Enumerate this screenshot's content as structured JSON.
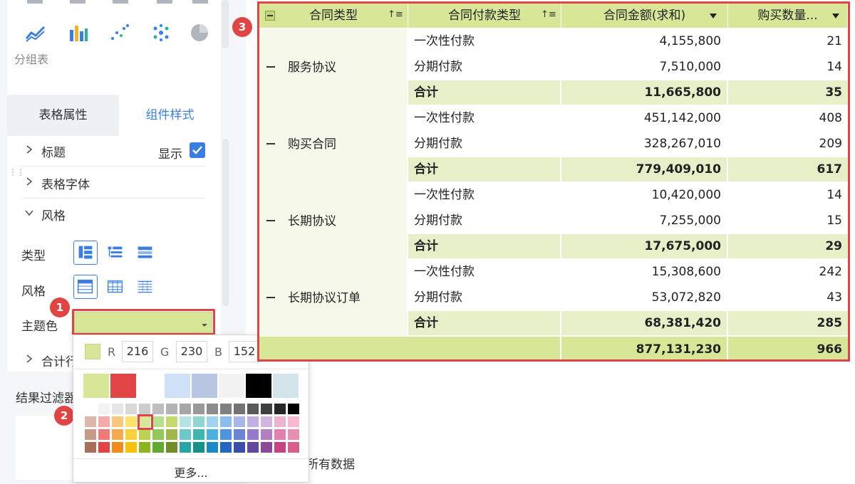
{
  "left_panel": {
    "chart_types_label": "分组表",
    "chart_icons": [
      "line-chart-icon",
      "bar-chart-icon",
      "scatter-chart-icon",
      "bubble-chart-icon",
      "pie-chart-icon"
    ],
    "tabs": [
      {
        "label": "表格属性",
        "active": false
      },
      {
        "label": "组件样式",
        "active": true
      }
    ],
    "sections": [
      {
        "label": "标题",
        "expanded": false
      },
      {
        "label": "表格字体",
        "expanded": false
      },
      {
        "label": "风格",
        "expanded": true
      },
      {
        "label": "合计行",
        "expanded": false
      }
    ],
    "show_label": "显示",
    "show_checked": true,
    "type_label": "类型",
    "style_label": "风格",
    "theme_label": "主题色",
    "theme_color": "#d8e698",
    "filter_label": "结果过滤器"
  },
  "color_picker": {
    "r_label": "R",
    "g_label": "G",
    "b_label": "B",
    "r": "216",
    "g": "230",
    "b": "152",
    "theme_colors": [
      "#d8e698",
      "#e04444",
      "#ffffff",
      "#cfe0f7",
      "#b8c6e4",
      "#f2f2f2",
      "#000000",
      "#d3e4ea"
    ],
    "more_label": "更多..."
  },
  "badges": [
    "1",
    "2",
    "3"
  ],
  "footer_text": "所有数据",
  "table": {
    "headers": [
      "合同类型",
      "合同付款类型",
      "合同金额(求和)",
      "购买数量..."
    ],
    "groups": [
      {
        "name": "服务协议",
        "rows": [
          {
            "type": "一次性付款",
            "amount": "4,155,800",
            "qty": "21"
          },
          {
            "type": "分期付款",
            "amount": "7,510,000",
            "qty": "14"
          }
        ],
        "total_label": "合计",
        "total_amount": "11,665,800",
        "total_qty": "35"
      },
      {
        "name": "购买合同",
        "rows": [
          {
            "type": "一次性付款",
            "amount": "451,142,000",
            "qty": "408"
          },
          {
            "type": "分期付款",
            "amount": "328,267,010",
            "qty": "209"
          }
        ],
        "total_label": "合计",
        "total_amount": "779,409,010",
        "total_qty": "617"
      },
      {
        "name": "长期协议",
        "rows": [
          {
            "type": "一次性付款",
            "amount": "10,420,000",
            "qty": "14"
          },
          {
            "type": "分期付款",
            "amount": "7,255,000",
            "qty": "15"
          }
        ],
        "total_label": "合计",
        "total_amount": "17,675,000",
        "total_qty": "29"
      },
      {
        "name": "长期协议订单",
        "rows": [
          {
            "type": "一次性付款",
            "amount": "15,308,600",
            "qty": "242"
          },
          {
            "type": "分期付款",
            "amount": "53,072,820",
            "qty": "43"
          }
        ],
        "total_label": "合计",
        "total_amount": "68,381,420",
        "total_qty": "285"
      }
    ],
    "grand_total_amount": "877,131,230",
    "grand_total_qty": "966",
    "colors": {
      "header": "#d8e698",
      "group_bg": "#f6f9ea",
      "subtotal": "#e7efc8",
      "grand": "#d8e698"
    }
  }
}
